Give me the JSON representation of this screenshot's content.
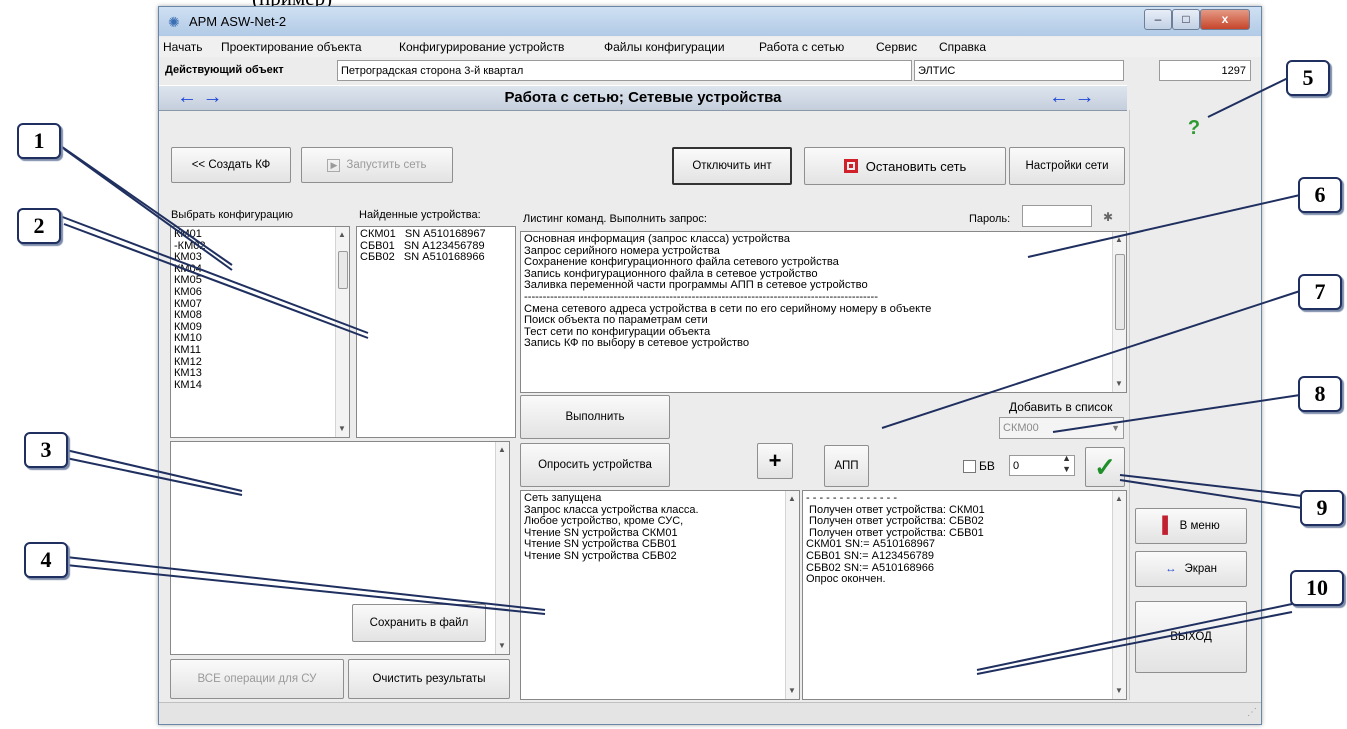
{
  "top_caption": "(пример)",
  "window": {
    "title": "АРМ ASW-Net-2",
    "controls": {
      "minimize": "–",
      "maximize": "□",
      "close": "x"
    }
  },
  "menu": [
    "Начать",
    "Проектирование объекта",
    "Конфигурирование устройств",
    "Файлы конфигурации",
    "Работа с сетью",
    "Сервис",
    "Справка"
  ],
  "object_bar": {
    "label": "Действующий объект",
    "object_name": "Петроградская сторона 3-й квартал",
    "company": "ЭЛТИС",
    "number": "1297"
  },
  "header": {
    "title": "Работа с сетью; Сетевые устройства",
    "left_arrows": "← →",
    "right_arrows": "← →"
  },
  "toolbar": {
    "create_kf": "<< Создать КФ",
    "start_net": "Запустить сеть",
    "disconnect": "Отключить инт",
    "stop_net": "Остановить сеть",
    "net_settings": "Настройки сети",
    "help": "?"
  },
  "config_panel": {
    "label": "Выбрать конфигурацию",
    "items": [
      "КМ01",
      "-КМ02",
      "КМ03",
      "КМ04",
      "КМ05",
      "КМ06",
      "КМ07",
      "КМ08",
      "КМ09",
      "КМ10",
      "КМ11",
      "КМ12",
      "КМ13",
      "КМ14"
    ]
  },
  "found_panel": {
    "label": "Найденные устройства:",
    "items": [
      "СКМ01   SN А510168967",
      "СБВ01   SN А123456789",
      "СБВ02   SN А510168966"
    ]
  },
  "commands_panel": {
    "label": "Листинг команд. Выполнить запрос:",
    "password_label": "Пароль:",
    "password_value": "",
    "items": [
      "Основная информация (запрос класса) устройства",
      "Запрос серийного номера устройства",
      "Сохранение конфигурационного файла сетевого устройства",
      "Запись конфигурационного файла в сетевое устройство",
      "Заливка переменной части программы АПП в сетевое устройство",
      "-----------------------------------------------------------------------------------------------",
      "Смена сетевого адреса устройства в сети по его серийному номеру в объекте",
      "Поиск объекта по параметрам сети",
      "Тест сети по конфигурации объекта",
      "Запись КФ по выбору в сетевое устройство"
    ]
  },
  "actions": {
    "execute": "Выполнить",
    "poll": "Опросить устройства",
    "plus": "+",
    "app": "АПП",
    "add_to_list_label": "Добавить в список",
    "add_to_list_value": "СКМ00",
    "bv_label": "БВ",
    "bv_value": "0",
    "ok": "✓"
  },
  "left_bottom": {
    "save": "Сохранить в файл",
    "all_ops": "ВСЕ операции для СУ",
    "clear": "Очистить результаты"
  },
  "log_left": [
    "Сеть запущена",
    "Запрос класса устройства класса.",
    "Любое устройство, кроме СУС,",
    "Чтение SN устройства СКМ01",
    "Чтение SN устройства СБВ01",
    "Чтение SN устройства СБВ02"
  ],
  "log_right": [
    "- - - - - - - - - - - - - -",
    " Получен ответ устройства: СКМ01",
    " Получен ответ устройства: СБВ02",
    " Получен ответ устройства: СБВ01",
    "СКМ01 SN:= А510168967",
    "СБВ01 SN:= А123456789",
    "СБВ02 SN:= А510168966",
    "Опрос окончен."
  ],
  "side": {
    "menu": "В меню",
    "screen": "Экран",
    "exit": "ВЫХОД"
  },
  "callouts": [
    "1",
    "2",
    "3",
    "4",
    "5",
    "6",
    "7",
    "8",
    "9",
    "10"
  ],
  "colors": {
    "callout_border": "#1f2f5f",
    "arrow": "#1f47d6",
    "stop_red": "#d0202a",
    "check_green": "#1f8f2a"
  }
}
